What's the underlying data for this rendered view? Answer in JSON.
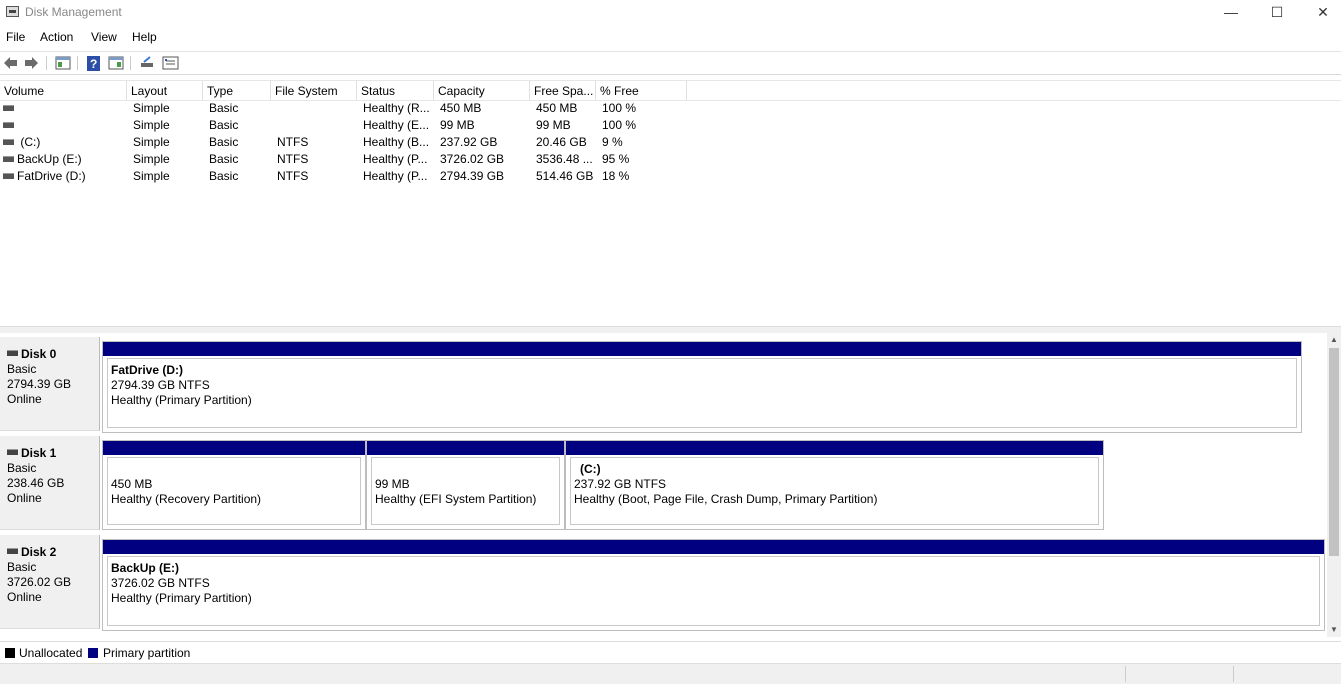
{
  "window": {
    "title": "Disk Management",
    "minimize": "—",
    "maximize": "☐",
    "close": "✕"
  },
  "menu": {
    "file": "File",
    "action": "Action",
    "view": "View",
    "help": "Help"
  },
  "list": {
    "columns": [
      "Volume",
      "Layout",
      "Type",
      "File System",
      "Status",
      "Capacity",
      "Free Spa...",
      "% Free"
    ],
    "rows": [
      {
        "volume": "",
        "layout": "Simple",
        "type": "Basic",
        "fs": "",
        "status": "Healthy (R...",
        "capacity": "450 MB",
        "free": "450 MB",
        "pct": "100 %"
      },
      {
        "volume": "",
        "layout": "Simple",
        "type": "Basic",
        "fs": "",
        "status": "Healthy (E...",
        "capacity": "99 MB",
        "free": "99 MB",
        "pct": "100 %"
      },
      {
        "volume": "(C:)",
        "layout": "Simple",
        "type": "Basic",
        "fs": "NTFS",
        "status": "Healthy (B...",
        "capacity": "237.92 GB",
        "free": "20.46 GB",
        "pct": "9 %"
      },
      {
        "volume": "BackUp (E:)",
        "layout": "Simple",
        "type": "Basic",
        "fs": "NTFS",
        "status": "Healthy (P...",
        "capacity": "3726.02 GB",
        "free": "3536.48 ...",
        "pct": "95 %"
      },
      {
        "volume": "FatDrive (D:)",
        "layout": "Simple",
        "type": "Basic",
        "fs": "NTFS",
        "status": "Healthy (P...",
        "capacity": "2794.39 GB",
        "free": "514.46 GB",
        "pct": "18 %"
      }
    ]
  },
  "disks": [
    {
      "name": "Disk 0",
      "type": "Basic",
      "size": "2794.39 GB",
      "state": "Online",
      "partitions": [
        {
          "name": "FatDrive  (D:)",
          "size": "2794.39 GB NTFS",
          "status": "Healthy (Primary Partition)"
        }
      ]
    },
    {
      "name": "Disk 1",
      "type": "Basic",
      "size": "238.46 GB",
      "state": "Online",
      "partitions": [
        {
          "name": "",
          "size": "450 MB",
          "status": "Healthy (Recovery Partition)"
        },
        {
          "name": "",
          "size": "99 MB",
          "status": "Healthy (EFI System Partition)"
        },
        {
          "name": "(C:)",
          "size": "237.92 GB NTFS",
          "status": "Healthy (Boot, Page File, Crash Dump, Primary Partition)"
        }
      ]
    },
    {
      "name": "Disk 2",
      "type": "Basic",
      "size": "3726.02 GB",
      "state": "Online",
      "partitions": [
        {
          "name": "BackUp  (E:)",
          "size": "3726.02 GB NTFS",
          "status": "Healthy (Primary Partition)"
        }
      ]
    }
  ],
  "legend": [
    {
      "label": "Unallocated",
      "color": "#000000"
    },
    {
      "label": "Primary partition",
      "color": "#000080"
    }
  ]
}
